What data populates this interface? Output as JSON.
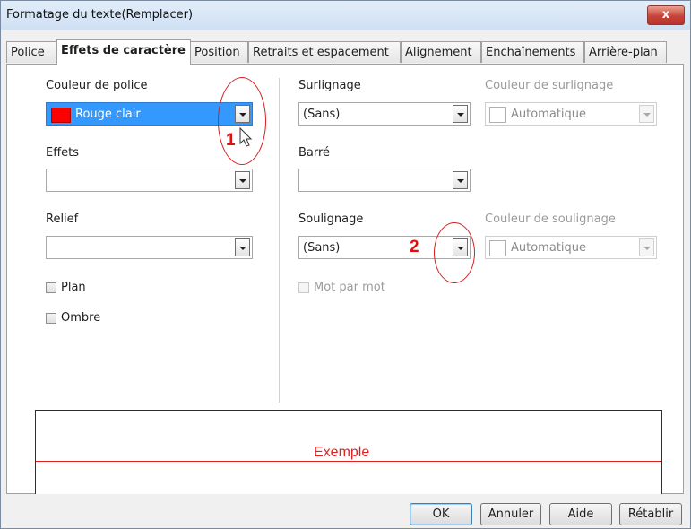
{
  "window": {
    "title": "Formatage du texte(Remplacer)",
    "close_label": "x"
  },
  "tabs": [
    {
      "label": "Police"
    },
    {
      "label": "Effets de caractère"
    },
    {
      "label": "Position"
    },
    {
      "label": "Retraits et espacement"
    },
    {
      "label": "Alignement"
    },
    {
      "label": "Enchaînements"
    },
    {
      "label": "Arrière-plan"
    }
  ],
  "left": {
    "font_color": {
      "label": "Couleur de police",
      "value": "Rouge clair",
      "swatch": "#ff0000"
    },
    "effects": {
      "label": "Effets",
      "value": ""
    },
    "relief": {
      "label": "Relief",
      "value": ""
    },
    "outline": {
      "label": "Plan"
    },
    "shadow": {
      "label": "Ombre"
    }
  },
  "right": {
    "highlight": {
      "label": "Surlignage",
      "value": "(Sans)"
    },
    "highlight_color": {
      "label": "Couleur de surlignage",
      "value": "Automatique"
    },
    "strikethrough": {
      "label": "Barré",
      "value": ""
    },
    "underline": {
      "label": "Soulignage",
      "value": "(Sans)"
    },
    "underline_color": {
      "label": "Couleur de soulignage",
      "value": "Automatique"
    },
    "word_by_word": {
      "label": "Mot par mot"
    }
  },
  "preview": {
    "text": "Exemple",
    "color": "#e41f1f"
  },
  "buttons": {
    "ok": "OK",
    "cancel": "Annuler",
    "help": "Aide",
    "reset": "Rétablir"
  },
  "annotations": {
    "marker1": "1",
    "marker2": "2",
    "color": "#e01010"
  }
}
